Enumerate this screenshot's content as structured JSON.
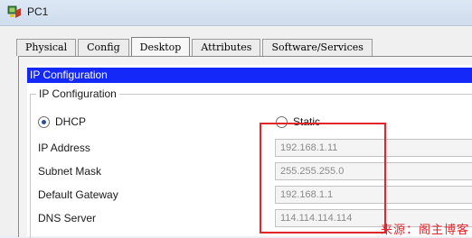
{
  "window": {
    "title": "PC1",
    "icon": "pc-app-icon"
  },
  "tabs": [
    {
      "label": "Physical",
      "active": false
    },
    {
      "label": "Config",
      "active": false
    },
    {
      "label": "Desktop",
      "active": true
    },
    {
      "label": "Attributes",
      "active": false
    },
    {
      "label": "Software/Services",
      "active": false
    }
  ],
  "ip_config": {
    "header": "IP Configuration",
    "group_title": "IP Configuration",
    "mode": {
      "dhcp_label": "DHCP",
      "static_label": "Static",
      "selected": "DHCP"
    },
    "fields": {
      "ip_address": {
        "label": "IP Address",
        "value": "192.168.1.11"
      },
      "subnet_mask": {
        "label": "Subnet Mask",
        "value": "255.255.255.0"
      },
      "default_gateway": {
        "label": "Default Gateway",
        "value": "192.168.1.1"
      },
      "dns_server": {
        "label": "DNS Server",
        "value": "114.114.114.114"
      }
    }
  },
  "annotation": {
    "highlight_color": "#e0262b",
    "watermark": "来源：阁主博客"
  },
  "colors": {
    "header_bg": "#1429f7",
    "header_text": "#ffffff"
  }
}
